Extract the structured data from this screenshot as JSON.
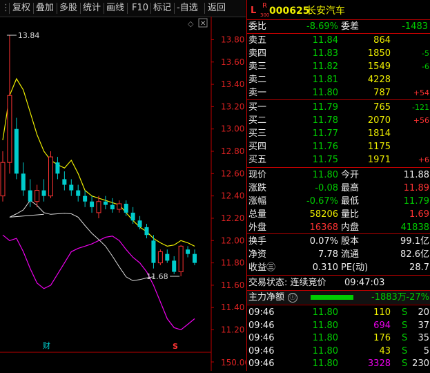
{
  "toolbar": {
    "items": [
      "复权",
      "叠加",
      "多股",
      "统计",
      "画线",
      "F10",
      "标记",
      "-自选",
      "返回"
    ]
  },
  "chart": {
    "y_ticks": [
      "13.80",
      "13.60",
      "13.40",
      "13.20",
      "13.00",
      "12.80",
      "12.60",
      "12.40",
      "12.20",
      "12.00",
      "11.80",
      "11.60",
      "11.40",
      "11.20",
      "150.00"
    ],
    "high_label": "13.84",
    "low_label": "11.68",
    "marker_cai": "财",
    "marker_s": "S",
    "diamond": "◇",
    "close_btn": "✕"
  },
  "chart_data": {
    "type": "candlestick",
    "candles": [
      {
        "o": 12.4,
        "h": 12.8,
        "l": 12.35,
        "c": 12.7,
        "up": true
      },
      {
        "o": 12.7,
        "h": 13.84,
        "l": 12.6,
        "c": 13.3,
        "up": true
      },
      {
        "o": 13.0,
        "h": 13.1,
        "l": 12.55,
        "c": 12.6,
        "up": false
      },
      {
        "o": 12.6,
        "h": 12.7,
        "l": 12.4,
        "c": 12.45,
        "up": false
      },
      {
        "o": 12.45,
        "h": 12.55,
        "l": 12.3,
        "c": 12.35,
        "up": false
      },
      {
        "o": 12.35,
        "h": 12.5,
        "l": 12.3,
        "c": 12.45,
        "up": true
      },
      {
        "o": 12.45,
        "h": 12.55,
        "l": 12.35,
        "c": 12.4,
        "up": false
      },
      {
        "o": 12.4,
        "h": 12.8,
        "l": 12.38,
        "c": 12.75,
        "up": true
      },
      {
        "o": 12.7,
        "h": 12.75,
        "l": 12.55,
        "c": 12.6,
        "up": false
      },
      {
        "o": 12.55,
        "h": 12.62,
        "l": 12.45,
        "c": 12.5,
        "up": false
      },
      {
        "o": 12.5,
        "h": 12.55,
        "l": 12.4,
        "c": 12.45,
        "up": false
      },
      {
        "o": 12.45,
        "h": 12.5,
        "l": 12.35,
        "c": 12.4,
        "up": false
      },
      {
        "o": 12.4,
        "h": 12.45,
        "l": 12.3,
        "c": 12.35,
        "up": false
      },
      {
        "o": 12.35,
        "h": 12.4,
        "l": 12.25,
        "c": 12.3,
        "up": false
      },
      {
        "o": 12.25,
        "h": 12.4,
        "l": 12.2,
        "c": 12.35,
        "up": true
      },
      {
        "o": 12.35,
        "h": 12.4,
        "l": 12.28,
        "c": 12.32,
        "up": false
      },
      {
        "o": 12.32,
        "h": 12.38,
        "l": 12.25,
        "c": 12.28,
        "up": false
      },
      {
        "o": 12.28,
        "h": 12.36,
        "l": 12.25,
        "c": 12.33,
        "up": true
      },
      {
        "o": 12.33,
        "h": 12.36,
        "l": 12.22,
        "c": 12.25,
        "up": false
      },
      {
        "o": 12.25,
        "h": 12.3,
        "l": 12.15,
        "c": 12.18,
        "up": false
      },
      {
        "o": 12.18,
        "h": 12.22,
        "l": 12.1,
        "c": 12.12,
        "up": false
      },
      {
        "o": 12.12,
        "h": 12.15,
        "l": 12.02,
        "c": 12.05,
        "up": false
      },
      {
        "o": 12.0,
        "h": 12.05,
        "l": 11.75,
        "c": 11.8,
        "up": false
      },
      {
        "o": 11.8,
        "h": 11.92,
        "l": 11.78,
        "c": 11.9,
        "up": true
      },
      {
        "o": 11.88,
        "h": 11.92,
        "l": 11.8,
        "c": 11.82,
        "up": false
      },
      {
        "o": 11.82,
        "h": 11.86,
        "l": 11.7,
        "c": 11.72,
        "up": false
      },
      {
        "o": 11.72,
        "h": 11.96,
        "l": 11.68,
        "c": 11.95,
        "up": true
      },
      {
        "o": 11.92,
        "h": 11.95,
        "l": 11.85,
        "c": 11.88,
        "up": false
      },
      {
        "o": 11.88,
        "h": 11.92,
        "l": 11.78,
        "c": 11.8,
        "up": false
      }
    ],
    "upper_band": [
      12.9,
      13.3,
      13.45,
      13.35,
      13.15,
      12.95,
      12.8,
      12.72,
      12.68,
      12.65,
      12.72,
      12.6,
      12.45,
      12.4,
      12.38,
      12.36,
      12.34,
      12.32,
      12.25,
      12.18,
      12.12,
      12.08,
      12.02,
      11.98,
      11.95,
      11.96,
      12.0,
      11.98,
      11.95
    ],
    "lower_band": [
      12.05,
      12.0,
      12.02,
      11.9,
      11.75,
      11.62,
      11.57,
      11.6,
      11.7,
      11.8,
      11.9,
      11.93,
      11.95,
      11.97,
      12.0,
      12.03,
      12.04,
      12.0,
      11.92,
      11.85,
      11.8,
      11.72,
      11.6,
      11.45,
      11.3,
      11.22,
      11.2,
      11.25,
      11.3
    ],
    "ylim": [
      11.1,
      13.9
    ]
  },
  "quote": {
    "mark": "L",
    "r": "R",
    "r_sub": "300",
    "code": "000625",
    "name": "长安汽车",
    "weibi_label": "委比",
    "weibi": "-8.69%",
    "weicha_label": "委差",
    "weicha": "-1483",
    "sell": [
      {
        "label": "卖五",
        "price": "11.84",
        "vol": "864",
        "chg": ""
      },
      {
        "label": "卖四",
        "price": "11.83",
        "vol": "1850",
        "chg": "-5"
      },
      {
        "label": "卖三",
        "price": "11.82",
        "vol": "1549",
        "chg": "-6"
      },
      {
        "label": "卖二",
        "price": "11.81",
        "vol": "4228",
        "chg": ""
      },
      {
        "label": "卖一",
        "price": "11.80",
        "vol": "787",
        "chg": "+54"
      }
    ],
    "buy": [
      {
        "label": "买一",
        "price": "11.79",
        "vol": "765",
        "chg": "-121"
      },
      {
        "label": "买二",
        "price": "11.78",
        "vol": "2070",
        "chg": "+56"
      },
      {
        "label": "买三",
        "price": "11.77",
        "vol": "1814",
        "chg": ""
      },
      {
        "label": "买四",
        "price": "11.76",
        "vol": "1175",
        "chg": ""
      },
      {
        "label": "买五",
        "price": "11.75",
        "vol": "1971",
        "chg": "+6"
      }
    ],
    "stats": [
      {
        "l1": "现价",
        "v1": "11.80",
        "l2": "今开",
        "v2": "11.88"
      },
      {
        "l1": "涨跌",
        "v1": "-0.08",
        "l2": "最高",
        "v2": "11.89"
      },
      {
        "l1": "涨幅",
        "v1": "-0.67%",
        "l2": "最低",
        "v2": "11.79"
      },
      {
        "l1": "总量",
        "v1": "58206",
        "l2": "量比",
        "v2": "1.69"
      },
      {
        "l1": "外盘",
        "v1": "16368",
        "l2": "内盘",
        "v2": "41838"
      }
    ],
    "stats2": [
      {
        "l1": "换手",
        "v1": "0.07%",
        "l2": "股本",
        "v2": "99.1亿"
      },
      {
        "l1": "净资",
        "v1": "7.78",
        "l2": "流通",
        "v2": "82.6亿"
      },
      {
        "l1": "收益㊂",
        "v1": "0.310",
        "l2": "PE(动)",
        "v2": "28.7"
      }
    ],
    "trade_state": "交易状态: 连续竞价",
    "trade_time": "09:47:03",
    "net_label": "主力净额",
    "net_info": "ⓘ",
    "net_value": "-1883万",
    "net_pct": "-27%",
    "ticks": [
      {
        "time": "09:46",
        "price": "11.80",
        "vol": "110",
        "side": "S",
        "n": "20"
      },
      {
        "time": "09:46",
        "price": "11.80",
        "vol": "694",
        "side": "S",
        "n": "37"
      },
      {
        "time": "09:46",
        "price": "11.80",
        "vol": "176",
        "side": "S",
        "n": "35"
      },
      {
        "time": "09:46",
        "price": "11.80",
        "vol": "43",
        "side": "S",
        "n": "5"
      },
      {
        "time": "09:46",
        "price": "11.80",
        "vol": "3328",
        "side": "S",
        "n": "230"
      }
    ]
  }
}
